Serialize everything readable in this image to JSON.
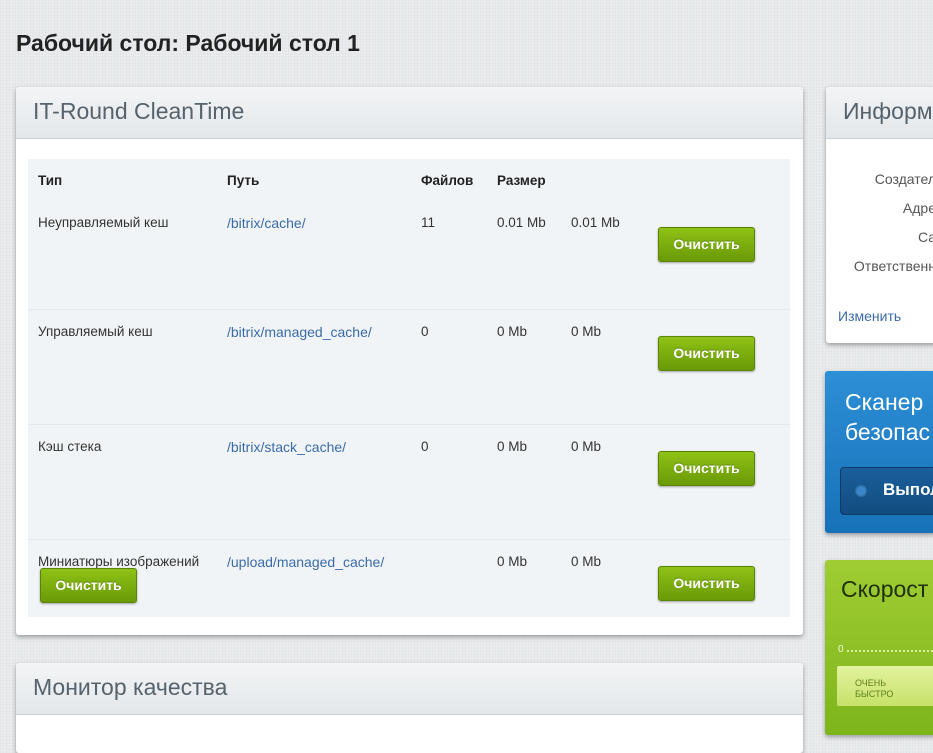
{
  "page": {
    "title": "Рабочий стол: Рабочий стол 1"
  },
  "cleantime": {
    "title": "IT-Round CleanTime",
    "headers": {
      "type": "Тип",
      "path": "Путь",
      "files": "Файлов",
      "size": "Размер"
    },
    "rows": [
      {
        "type": "Неуправляемый кеш",
        "path": "/bitrix/cache/",
        "files": "11",
        "size1": "0.01 Mb",
        "size2": "0.01 Mb",
        "button": "Очистить"
      },
      {
        "type": "Управляемый кеш",
        "path": "/bitrix/managed_cache/",
        "files": "0",
        "size1": "0 Mb",
        "size2": "0 Mb",
        "button": "Очистить"
      },
      {
        "type": "Кэш стека",
        "path": "/bitrix/stack_cache/",
        "files": "0",
        "size1": "0 Mb",
        "size2": "0 Mb",
        "button": "Очистить"
      },
      {
        "type": "Миниатюры изображений",
        "path": "/upload/managed_cache/",
        "files": "",
        "size1": "0 Mb",
        "size2": "0 Mb",
        "button": "Очистить"
      }
    ],
    "clean_all_label": "Очистить"
  },
  "monitor": {
    "title": "Монитор качества"
  },
  "info": {
    "title": "Информа",
    "lines": [
      "Создател",
      "Адре",
      "Са",
      "Ответственн"
    ],
    "edit_link": "Изменить"
  },
  "scanner": {
    "title_line1": "Сканер",
    "title_line2": "безопас",
    "button": "Выпол"
  },
  "speed": {
    "title": "Скорост",
    "scale_zero": "0",
    "bar_label_line1": "ОЧЕНЬ",
    "bar_label_line2": "БЫСТРО"
  },
  "colors": {
    "button_green": "#7aab0c",
    "link": "#3a6ba9",
    "scanner_blue": "#1f7fc8",
    "speed_green": "#8dc125"
  }
}
